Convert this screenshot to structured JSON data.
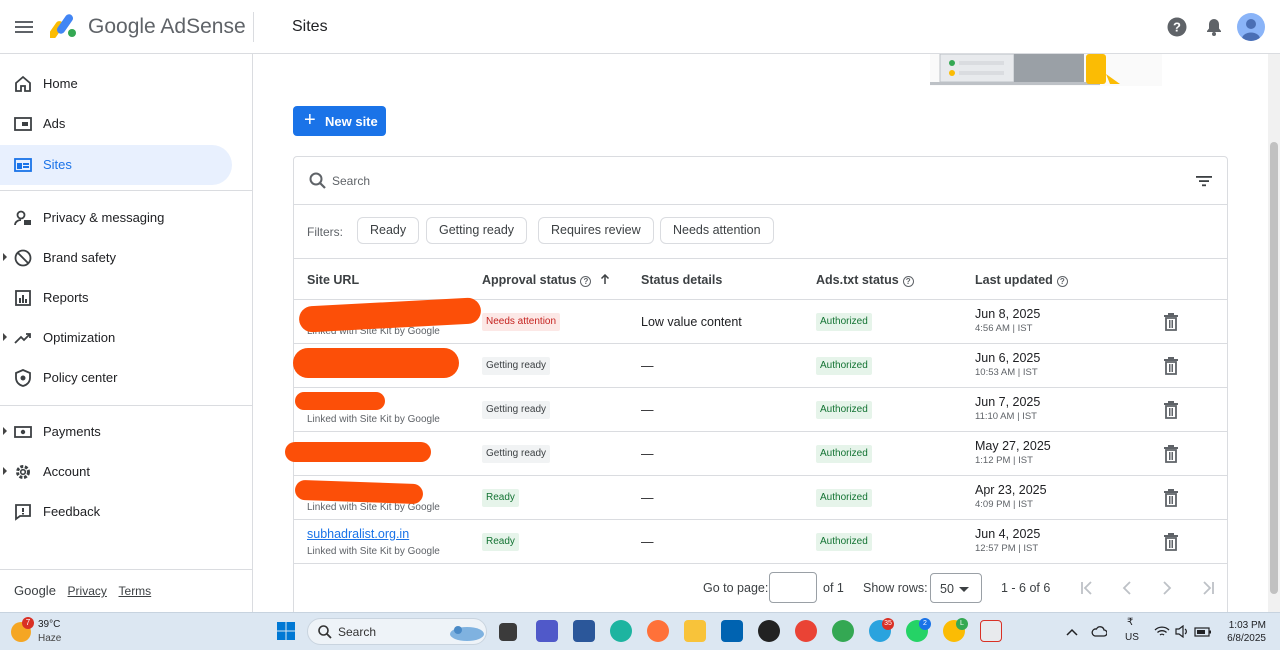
{
  "app": {
    "brand": "Google AdSense",
    "page_title": "Sites"
  },
  "sidebar": {
    "items": [
      {
        "label": "Home",
        "icon": "home-icon"
      },
      {
        "label": "Ads",
        "icon": "ads-icon"
      },
      {
        "label": "Sites",
        "icon": "sites-icon",
        "active": true
      },
      {
        "label": "Privacy & messaging",
        "icon": "privacy-icon"
      },
      {
        "label": "Brand safety",
        "icon": "block-icon"
      },
      {
        "label": "Reports",
        "icon": "reports-icon"
      },
      {
        "label": "Optimization",
        "icon": "trending-icon"
      },
      {
        "label": "Policy center",
        "icon": "shield-icon"
      },
      {
        "label": "Payments",
        "icon": "payments-icon"
      },
      {
        "label": "Account",
        "icon": "gear-icon"
      },
      {
        "label": "Feedback",
        "icon": "feedback-icon"
      }
    ],
    "footer": {
      "google": "Google",
      "privacy": "Privacy",
      "terms": "Terms"
    }
  },
  "main": {
    "new_site_label": "New site",
    "search": {
      "placeholder": "Search"
    },
    "filters": {
      "label": "Filters:",
      "chips": [
        "Ready",
        "Getting ready",
        "Requires review",
        "Needs attention"
      ]
    },
    "table": {
      "headers": {
        "site_url": "Site URL",
        "approval": "Approval status",
        "details": "Status details",
        "adstxt": "Ads.txt status",
        "updated": "Last updated"
      },
      "rows": [
        {
          "url": "",
          "sub": "Linked with Site Kit by Google",
          "status": "Needs attention",
          "details": "Low value content",
          "adstxt": "Authorized",
          "date": "Jun 8, 2025",
          "time": "4:56 AM | IST"
        },
        {
          "url": "",
          "sub": "",
          "status": "Getting ready",
          "details": "—",
          "adstxt": "Authorized",
          "date": "Jun 6, 2025",
          "time": "10:53 AM | IST"
        },
        {
          "url": "",
          "sub": "Linked with Site Kit by Google",
          "status": "Getting ready",
          "details": "—",
          "adstxt": "Authorized",
          "date": "Jun 7, 2025",
          "time": "11:10 AM | IST"
        },
        {
          "url": "",
          "sub": "",
          "status": "Getting ready",
          "details": "—",
          "adstxt": "Authorized",
          "date": "May 27, 2025",
          "time": "1:12 PM | IST"
        },
        {
          "url": "",
          "sub": "Linked with Site Kit by Google",
          "status": "Ready",
          "details": "—",
          "adstxt": "Authorized",
          "date": "Apr 23, 2025",
          "time": "4:09 PM | IST"
        },
        {
          "url": "subhadralist.org.in",
          "sub": "Linked with Site Kit by Google",
          "status": "Ready",
          "details": "—",
          "adstxt": "Authorized",
          "date": "Jun 4, 2025",
          "time": "12:57 PM | IST"
        }
      ]
    },
    "pager": {
      "goto_label": "Go to page:",
      "goto_value": "",
      "of_label": "of 1",
      "rows_label": "Show rows:",
      "rows_value": "50",
      "range": "1 - 6 of 6"
    }
  },
  "colors": {
    "accent": "#1a73e8",
    "active_bg": "#e8f0fe",
    "redaction": "#fc4f08"
  },
  "taskbar": {
    "weather": {
      "temp": "39°C",
      "condition": "Haze",
      "badge": "7"
    },
    "search_label": "Search",
    "badges": {
      "telegram": "35",
      "whatsapp": "2",
      "chrome_profile": "L"
    },
    "tray": {
      "lang_symbol": "₹",
      "lang": "US"
    },
    "clock": {
      "time": "1:03 PM",
      "date": "6/8/2025"
    }
  }
}
